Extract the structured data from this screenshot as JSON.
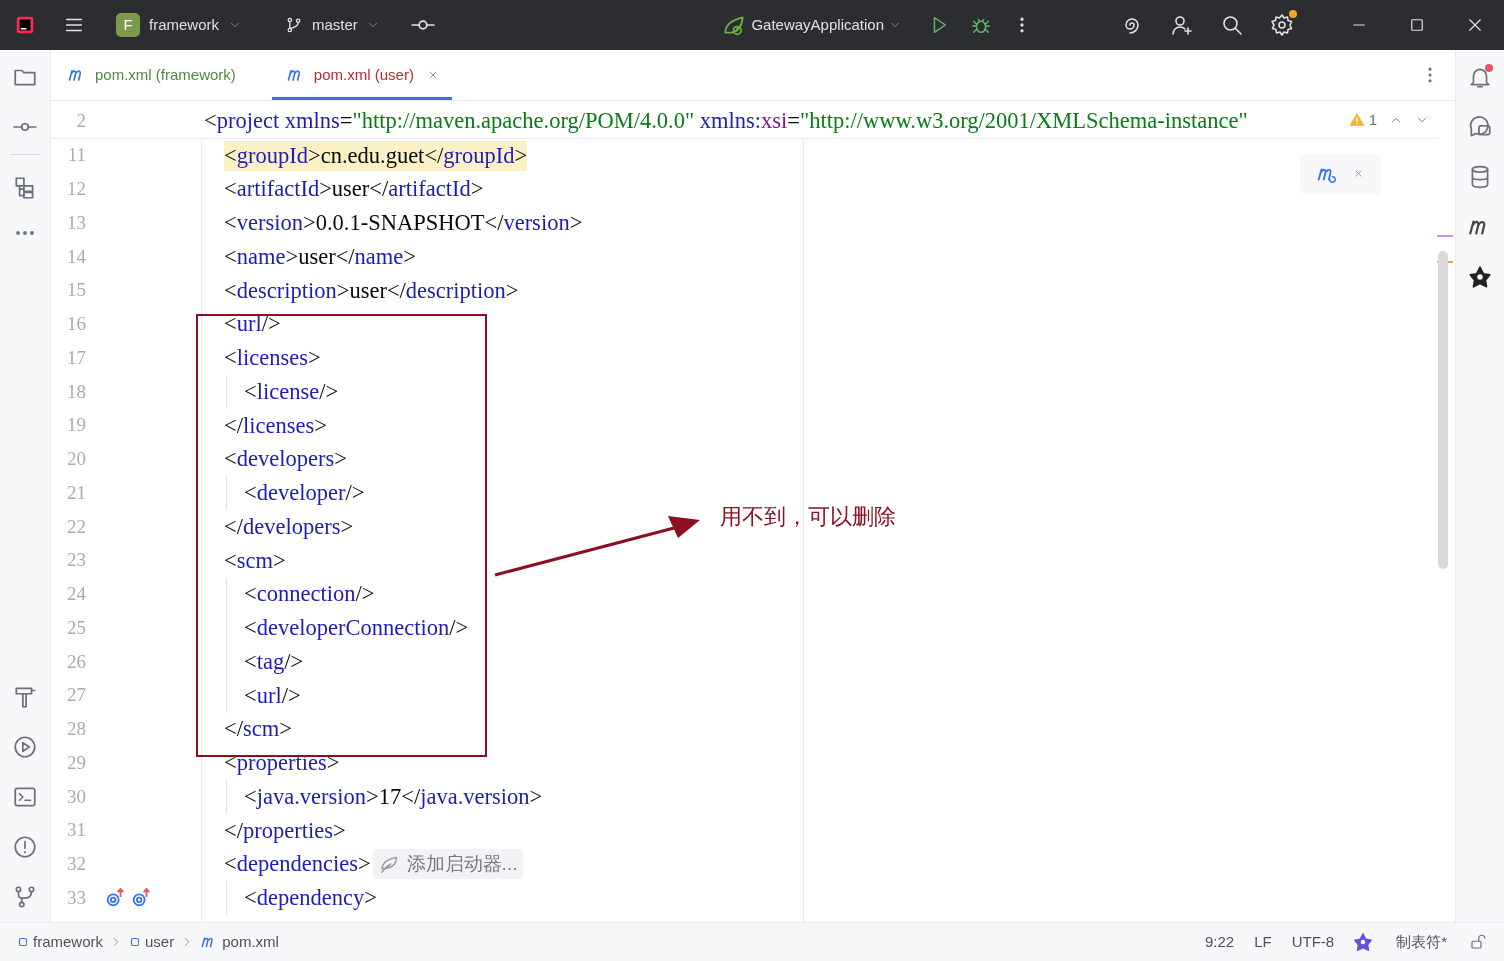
{
  "title_bar": {
    "project_initial": "F",
    "project": "framework",
    "branch": "master",
    "run_config": "GatewayApplication"
  },
  "tabs": [
    {
      "label": "pom.xml (framework)",
      "selected": false,
      "color": "#4f8a3f"
    },
    {
      "label": "pom.xml (user)",
      "selected": true,
      "color": "#c0282d"
    }
  ],
  "editor": {
    "sticky_line": {
      "number": "2",
      "highlighted": false,
      "tokens": [
        {
          "kind": "punct",
          "text": "<"
        },
        {
          "kind": "tag",
          "text": "project "
        },
        {
          "kind": "attr",
          "text": "xmlns"
        },
        {
          "kind": "punct",
          "text": "="
        },
        {
          "kind": "value",
          "text": "\"http://maven.apache.org/POM/4.0.0\" "
        },
        {
          "kind": "attr",
          "text": "xmlns:"
        },
        {
          "kind": "ns",
          "text": "xsi"
        },
        {
          "kind": "punct",
          "text": "="
        },
        {
          "kind": "value",
          "text": "\"http://www.w3.org/2001/XMLSchema-instance\""
        }
      ]
    },
    "problems": "1",
    "lines": [
      {
        "number": "11",
        "highlighted": true,
        "tokens": [
          {
            "kind": "punct",
            "text": "<"
          },
          {
            "kind": "tag",
            "text": "groupId"
          },
          {
            "kind": "punct",
            "text": ">"
          },
          {
            "kind": "text",
            "text": "cn.edu.guet"
          },
          {
            "kind": "punct",
            "text": "</"
          },
          {
            "kind": "tag",
            "text": "groupId"
          },
          {
            "kind": "punct",
            "text": ">"
          }
        ]
      },
      {
        "number": "12",
        "highlighted": false,
        "tokens": [
          {
            "kind": "punct",
            "text": "<"
          },
          {
            "kind": "tag",
            "text": "artifactId"
          },
          {
            "kind": "punct",
            "text": ">"
          },
          {
            "kind": "text",
            "text": "user"
          },
          {
            "kind": "punct",
            "text": "</"
          },
          {
            "kind": "tag",
            "text": "artifactId"
          },
          {
            "kind": "punct",
            "text": ">"
          }
        ]
      },
      {
        "number": "13",
        "highlighted": false,
        "tokens": [
          {
            "kind": "punct",
            "text": "<"
          },
          {
            "kind": "tag",
            "text": "version"
          },
          {
            "kind": "punct",
            "text": ">"
          },
          {
            "kind": "text",
            "text": "0.0.1-SNAPSHOT"
          },
          {
            "kind": "punct",
            "text": "</"
          },
          {
            "kind": "tag",
            "text": "version"
          },
          {
            "kind": "punct",
            "text": ">"
          }
        ]
      },
      {
        "number": "14",
        "highlighted": false,
        "tokens": [
          {
            "kind": "punct",
            "text": "<"
          },
          {
            "kind": "tag",
            "text": "name"
          },
          {
            "kind": "punct",
            "text": ">"
          },
          {
            "kind": "text",
            "text": "user"
          },
          {
            "kind": "punct",
            "text": "</"
          },
          {
            "kind": "tag",
            "text": "name"
          },
          {
            "kind": "punct",
            "text": ">"
          }
        ]
      },
      {
        "number": "15",
        "highlighted": false,
        "tokens": [
          {
            "kind": "punct",
            "text": "<"
          },
          {
            "kind": "tag",
            "text": "description"
          },
          {
            "kind": "punct",
            "text": ">"
          },
          {
            "kind": "text",
            "text": "user"
          },
          {
            "kind": "punct",
            "text": "</"
          },
          {
            "kind": "tag",
            "text": "description"
          },
          {
            "kind": "punct",
            "text": ">"
          }
        ]
      },
      {
        "number": "16",
        "highlighted": false,
        "tokens": [
          {
            "kind": "punct",
            "text": "<"
          },
          {
            "kind": "tag",
            "text": "url"
          },
          {
            "kind": "punct",
            "text": "/>"
          }
        ]
      },
      {
        "number": "17",
        "highlighted": false,
        "tokens": [
          {
            "kind": "punct",
            "text": "<"
          },
          {
            "kind": "tag",
            "text": "licenses"
          },
          {
            "kind": "punct",
            "text": ">"
          }
        ],
        "children": [
          {
            "number": "18",
            "highlighted": false,
            "tokens": [
              {
                "kind": "punct",
                "text": "<"
              },
              {
                "kind": "tag",
                "text": "license"
              },
              {
                "kind": "punct",
                "text": "/>"
              }
            ]
          }
        ]
      },
      {
        "number": "19",
        "highlighted": false,
        "tokens": [
          {
            "kind": "punct",
            "text": "</"
          },
          {
            "kind": "tag",
            "text": "licenses"
          },
          {
            "kind": "punct",
            "text": ">"
          }
        ]
      },
      {
        "number": "20",
        "highlighted": false,
        "tokens": [
          {
            "kind": "punct",
            "text": "<"
          },
          {
            "kind": "tag",
            "text": "developers"
          },
          {
            "kind": "punct",
            "text": ">"
          }
        ],
        "children": [
          {
            "number": "21",
            "highlighted": false,
            "tokens": [
              {
                "kind": "punct",
                "text": "<"
              },
              {
                "kind": "tag",
                "text": "developer"
              },
              {
                "kind": "punct",
                "text": "/>"
              }
            ]
          }
        ]
      },
      {
        "number": "22",
        "highlighted": false,
        "tokens": [
          {
            "kind": "punct",
            "text": "</"
          },
          {
            "kind": "tag",
            "text": "developers"
          },
          {
            "kind": "punct",
            "text": ">"
          }
        ]
      },
      {
        "number": "23",
        "highlighted": false,
        "tokens": [
          {
            "kind": "punct",
            "text": "<"
          },
          {
            "kind": "tag",
            "text": "scm"
          },
          {
            "kind": "punct",
            "text": ">"
          }
        ],
        "children": [
          {
            "number": "24",
            "highlighted": false,
            "tokens": [
              {
                "kind": "punct",
                "text": "<"
              },
              {
                "kind": "tag",
                "text": "connection"
              },
              {
                "kind": "punct",
                "text": "/>"
              }
            ]
          },
          {
            "number": "25",
            "highlighted": false,
            "tokens": [
              {
                "kind": "punct",
                "text": "<"
              },
              {
                "kind": "tag",
                "text": "developerConnection"
              },
              {
                "kind": "punct",
                "text": "/>"
              }
            ]
          },
          {
            "number": "26",
            "highlighted": false,
            "tokens": [
              {
                "kind": "punct",
                "text": "<"
              },
              {
                "kind": "tag",
                "text": "tag"
              },
              {
                "kind": "punct",
                "text": "/>"
              }
            ]
          },
          {
            "number": "27",
            "highlighted": false,
            "tokens": [
              {
                "kind": "punct",
                "text": "<"
              },
              {
                "kind": "tag",
                "text": "url"
              },
              {
                "kind": "punct",
                "text": "/>"
              }
            ]
          }
        ]
      },
      {
        "number": "28",
        "highlighted": false,
        "tokens": [
          {
            "kind": "punct",
            "text": "</"
          },
          {
            "kind": "tag",
            "text": "scm"
          },
          {
            "kind": "punct",
            "text": ">"
          }
        ]
      },
      {
        "number": "29",
        "highlighted": false,
        "tokens": [
          {
            "kind": "punct",
            "text": "<"
          },
          {
            "kind": "tag",
            "text": "properties"
          },
          {
            "kind": "punct",
            "text": ">"
          }
        ],
        "children": [
          {
            "number": "30",
            "highlighted": false,
            "tokens": [
              {
                "kind": "punct",
                "text": "<"
              },
              {
                "kind": "tag",
                "text": "java.version"
              },
              {
                "kind": "punct",
                "text": ">"
              },
              {
                "kind": "text",
                "text": "17"
              },
              {
                "kind": "punct",
                "text": "</"
              },
              {
                "kind": "tag",
                "text": "java.version"
              },
              {
                "kind": "punct",
                "text": ">"
              }
            ]
          }
        ]
      },
      {
        "number": "31",
        "highlighted": false,
        "tokens": [
          {
            "kind": "punct",
            "text": "</"
          },
          {
            "kind": "tag",
            "text": "properties"
          },
          {
            "kind": "punct",
            "text": ">"
          }
        ]
      },
      {
        "number": "32",
        "highlighted": false,
        "hint": "添加启动器...",
        "tokens": [
          {
            "kind": "punct",
            "text": "<"
          },
          {
            "kind": "tag",
            "text": "dependencies"
          },
          {
            "kind": "punct",
            "text": ">"
          }
        ],
        "children": [
          {
            "number": "33",
            "highlighted": false,
            "gutter": [
              {
                "kind": "override"
              },
              {
                "kind": "override"
              }
            ],
            "tokens": [
              {
                "kind": "punct",
                "text": "<"
              },
              {
                "kind": "tag",
                "text": "dependency"
              },
              {
                "kind": "punct",
                "text": ">"
              }
            ]
          }
        ]
      }
    ],
    "annotation": {
      "text": "用不到，可以删除"
    }
  },
  "status_bar": {
    "breadcrumbs": [
      {
        "kind": "module",
        "label": "framework"
      },
      {
        "kind": "module",
        "label": "user"
      },
      {
        "kind": "maven",
        "label": "pom.xml"
      }
    ],
    "position": "9:22",
    "line_ending": "LF",
    "encoding": "UTF-8",
    "indent": "制表符*"
  }
}
